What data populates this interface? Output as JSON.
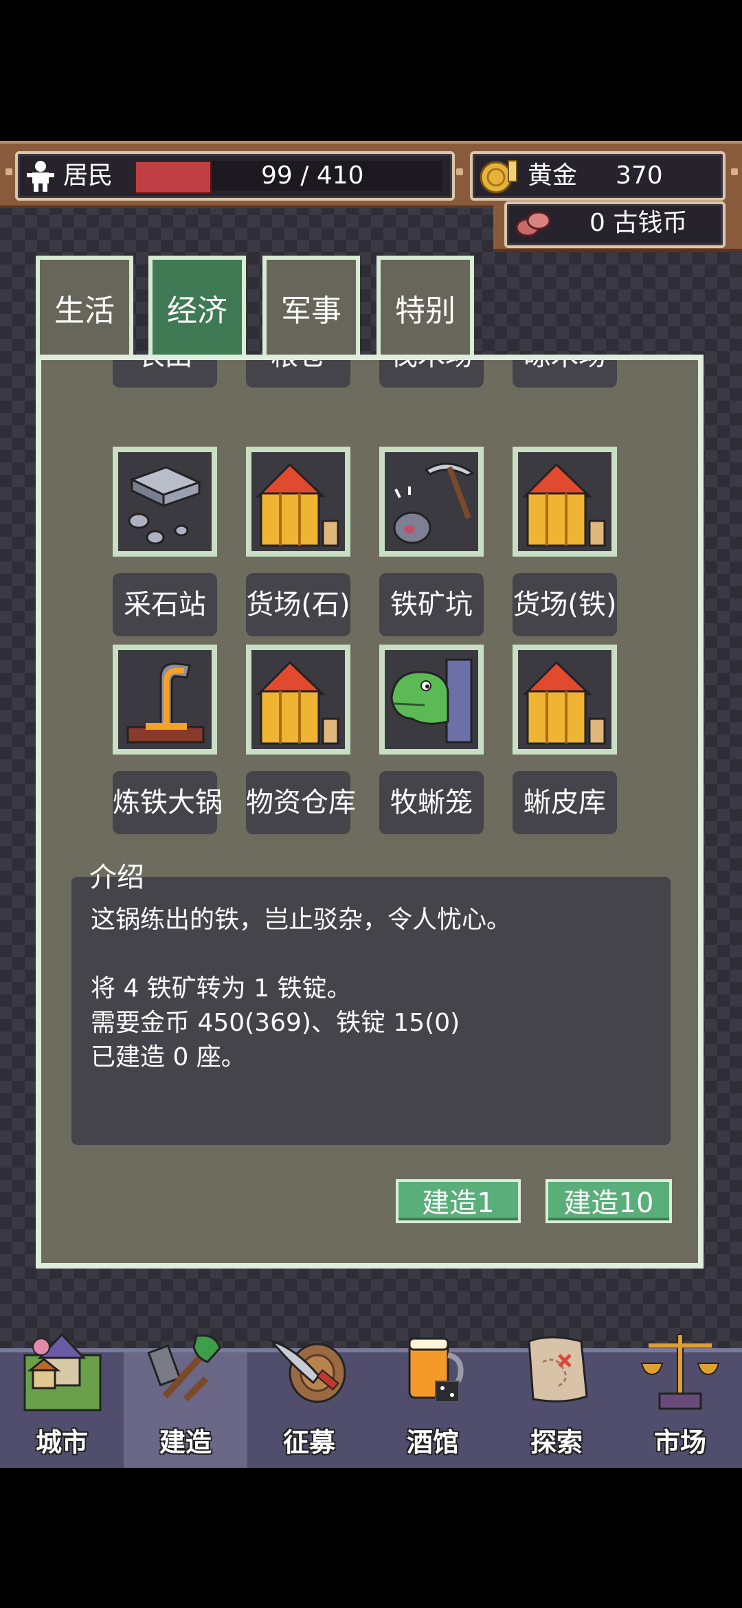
{
  "resources": {
    "population_label": "居民",
    "population_value": "99 / 410",
    "population_fraction": 0.241,
    "gold_label": "黄金",
    "gold_value": "370",
    "coin_value": "0 古钱币"
  },
  "tabs": [
    {
      "label": "生活"
    },
    {
      "label": "经济"
    },
    {
      "label": "军事"
    },
    {
      "label": "特别"
    }
  ],
  "buildings": [
    {
      "label": "农田",
      "icon": "farm-icon"
    },
    {
      "label": "粮仓",
      "icon": "granary-icon"
    },
    {
      "label": "伐木场",
      "icon": "lumber-icon"
    },
    {
      "label": "晾木场",
      "icon": "wood-yard-icon"
    },
    {
      "label": "采石站",
      "icon": "stone-icon"
    },
    {
      "label": "货场(石)",
      "icon": "warehouse-icon"
    },
    {
      "label": "铁矿坑",
      "icon": "pickaxe-ore-icon"
    },
    {
      "label": "货场(铁)",
      "icon": "warehouse-icon"
    },
    {
      "label": "炼铁大锅",
      "icon": "furnace-icon"
    },
    {
      "label": "物资仓库",
      "icon": "warehouse-icon"
    },
    {
      "label": "牧蜥笼",
      "icon": "lizard-icon"
    },
    {
      "label": "蜥皮库",
      "icon": "warehouse-icon"
    }
  ],
  "description": {
    "title": "介绍",
    "line1": "这锅练出的铁，岂止驳杂，令人忧心。",
    "line2": "将 4 铁矿转为 1 铁锭。",
    "line3": "需要金币 450(369)、铁锭 15(0)",
    "line4": "已建造 0 座。"
  },
  "actions": {
    "build1": "建造1",
    "build10": "建造10"
  },
  "nav": [
    {
      "label": "城市",
      "icon": "city-icon"
    },
    {
      "label": "建造",
      "icon": "build-icon"
    },
    {
      "label": "征募",
      "icon": "recruit-icon"
    },
    {
      "label": "酒馆",
      "icon": "tavern-icon"
    },
    {
      "label": "探索",
      "icon": "map-icon"
    },
    {
      "label": "市场",
      "icon": "scale-icon"
    }
  ],
  "colors": {
    "tab_active": "#3f7a55",
    "button": "#5aae7a",
    "hp": "#c03f45"
  }
}
